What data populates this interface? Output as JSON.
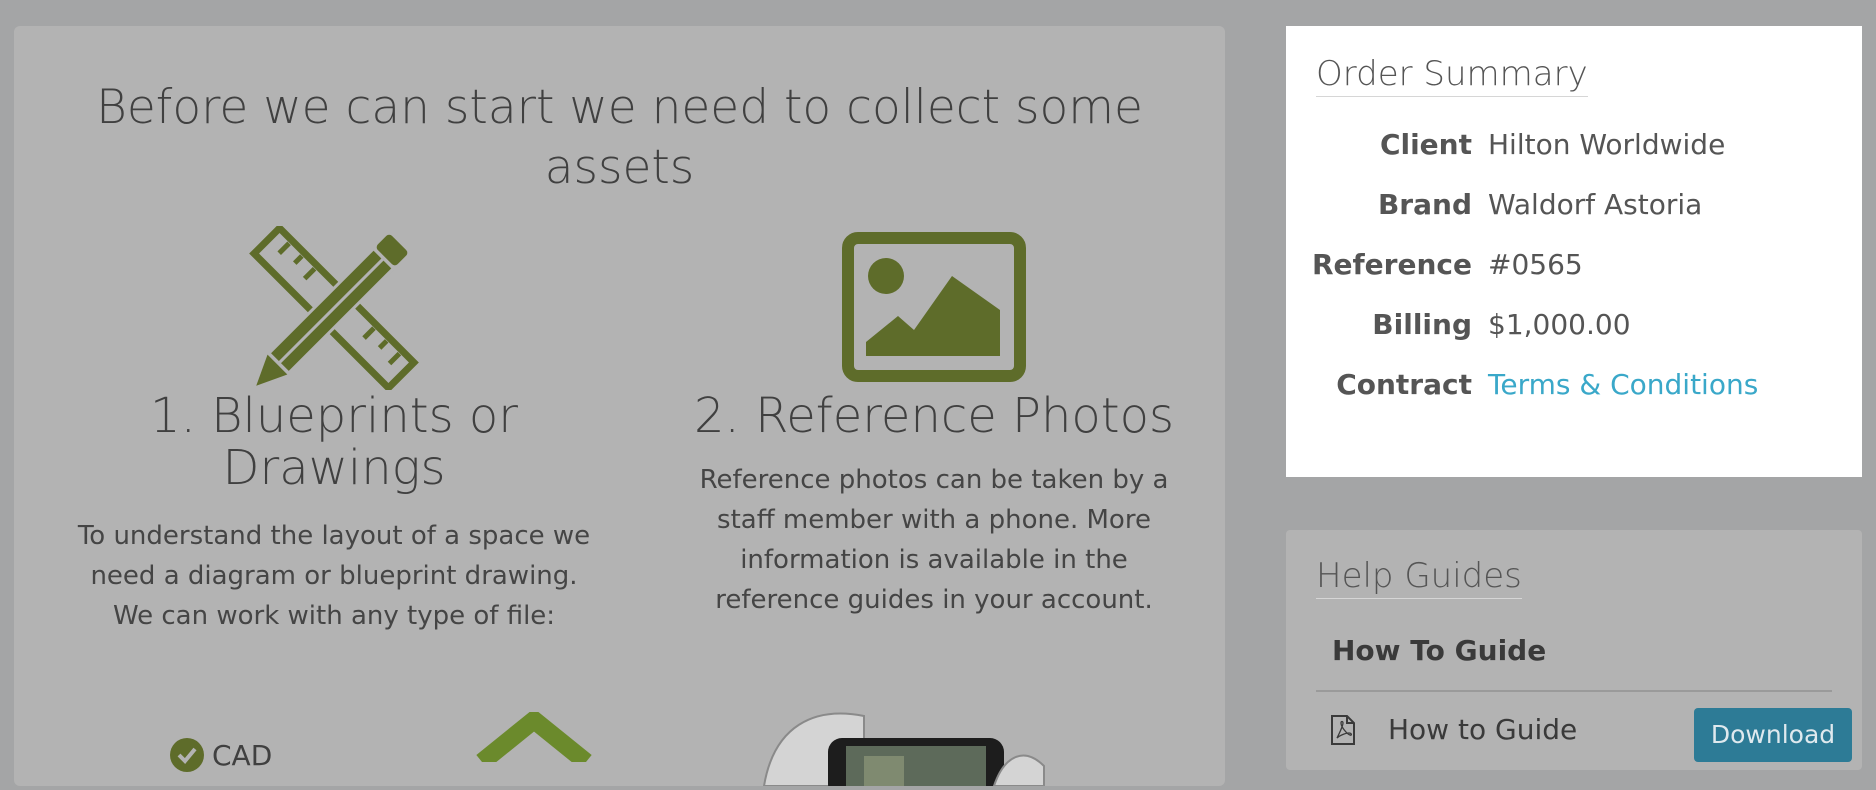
{
  "main": {
    "title": "Before we can start we need to collect some assets",
    "steps": [
      {
        "icon": "pencil-ruler-icon",
        "title": "1. Blueprints or Drawings",
        "description": "To understand the layout of a space we need a diagram or blueprint drawing. We can work with any type of file:",
        "file_types": [
          "CAD"
        ]
      },
      {
        "icon": "image-icon",
        "title": "2. Reference Photos",
        "description": "Reference photos can be taken by a staff member with a phone. More information is available in the reference guides in your account."
      }
    ],
    "accent_color": "#5e6c2a"
  },
  "order_summary": {
    "title": "Order Summary",
    "rows": [
      {
        "label": "Client",
        "value": "Hilton Worldwide"
      },
      {
        "label": "Brand",
        "value": "Waldorf Astoria"
      },
      {
        "label": "Reference",
        "value": "#0565"
      },
      {
        "label": "Billing",
        "value": "$1,000.00"
      },
      {
        "label": "Contract",
        "value": "Terms & Conditions"
      }
    ],
    "link_color": "#3aa8c9"
  },
  "help_guides": {
    "title": "Help Guides",
    "section": "How To Guide",
    "items": [
      {
        "icon": "pdf-file-icon",
        "name": "How to Guide",
        "action": "Download"
      }
    ]
  }
}
